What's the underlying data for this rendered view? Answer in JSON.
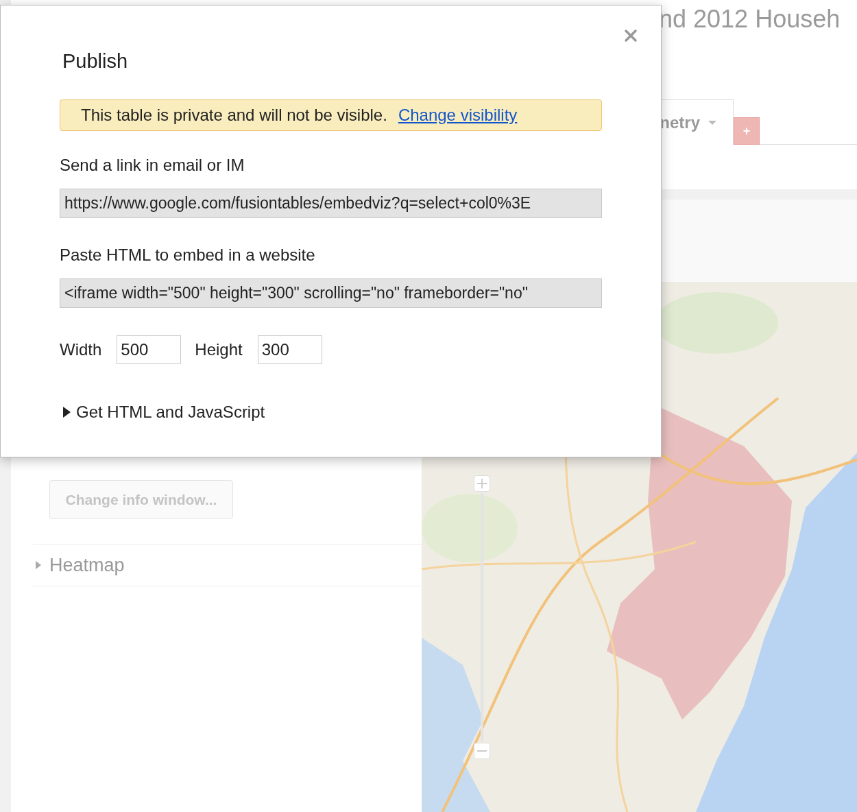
{
  "background": {
    "title": "nd 2012 Househ",
    "tab": {
      "label": "netry",
      "selected": true
    },
    "add_button": "+",
    "info_button": "Change info window...",
    "sections": [
      {
        "label": "Heatmap",
        "expanded": false
      }
    ]
  },
  "dialog": {
    "title": "Publish",
    "notice": {
      "text": "This table is private and will not be visible.",
      "link": "Change visibility"
    },
    "link_label": "Send a link in email or IM",
    "link_value": "https://www.google.com/fusiontables/embedviz?q=select+col0%3E",
    "embed_label": "Paste HTML to embed in a website",
    "embed_value": "<iframe width=\"500\" height=\"300\" scrolling=\"no\" frameborder=\"no\"",
    "width_label": "Width",
    "width_value": "500",
    "height_label": "Height",
    "height_value": "300",
    "expander": {
      "label": "Get HTML and JavaScript",
      "expanded": false
    }
  }
}
